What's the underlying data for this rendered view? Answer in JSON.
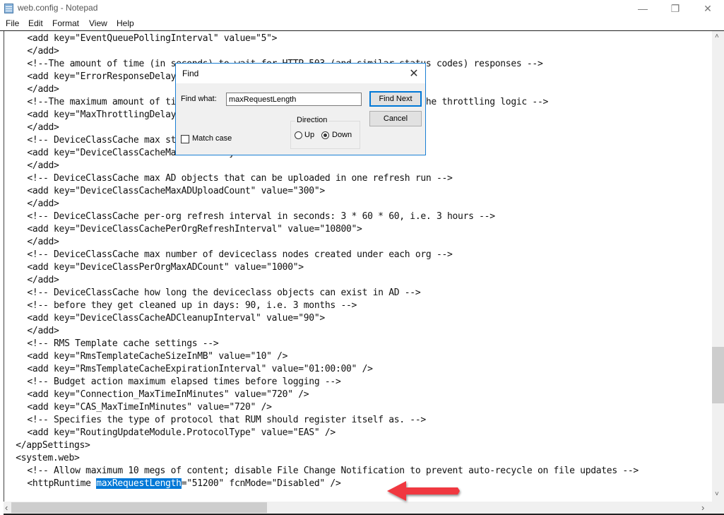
{
  "window": {
    "title": "web.config - Notepad",
    "minimize_glyph": "—",
    "maximize_glyph": "❐",
    "close_glyph": "✕"
  },
  "menu": [
    "File",
    "Edit",
    "Format",
    "View",
    "Help"
  ],
  "editor": {
    "lines": [
      {
        "indent": 4,
        "text": "<add key=\"EventQueuePollingInterval\" value=\"5\">"
      },
      {
        "indent": 4,
        "text": "</add>"
      },
      {
        "indent": 4,
        "text": "<!--The amount of time (in seconds) to wait for HTTP 503 (and similar status codes) responses -->"
      },
      {
        "indent": 4,
        "text": "<add key=\"ErrorResponseDelay\" value=\"0\">"
      },
      {
        "indent": 4,
        "text": "</add>"
      },
      {
        "indent": 4,
        "text": "<!--The maximum amount of time (in seconds) for requests to be delayed by the throttling logic -->"
      },
      {
        "indent": 4,
        "text": "<add key=\"MaxThrottlingDelay\" value=\"0\">"
      },
      {
        "indent": 4,
        "text": "</add>"
      },
      {
        "indent": 4,
        "text": "<!-- DeviceClassCache max start delay in seconds: 6 hours -->"
      },
      {
        "indent": 4,
        "text": "<add key=\"DeviceClassCacheMaxStartDelay\" value=\"21600\">"
      },
      {
        "indent": 4,
        "text": "</add>"
      },
      {
        "indent": 4,
        "text": "<!-- DeviceClassCache max AD objects that can be uploaded in one refresh run -->"
      },
      {
        "indent": 4,
        "text": "<add key=\"DeviceClassCacheMaxADUploadCount\" value=\"300\">"
      },
      {
        "indent": 4,
        "text": "</add>"
      },
      {
        "indent": 4,
        "text": "<!-- DeviceClassCache per-org refresh interval in seconds: 3 * 60 * 60, i.e. 3 hours -->"
      },
      {
        "indent": 4,
        "text": "<add key=\"DeviceClassCachePerOrgRefreshInterval\" value=\"10800\">"
      },
      {
        "indent": 4,
        "text": "</add>"
      },
      {
        "indent": 4,
        "text": "<!-- DeviceClassCache max number of deviceclass nodes created under each org -->"
      },
      {
        "indent": 4,
        "text": "<add key=\"DeviceClassPerOrgMaxADCount\" value=\"1000\">"
      },
      {
        "indent": 4,
        "text": "</add>"
      },
      {
        "indent": 4,
        "text": "<!-- DeviceClassCache how long the deviceclass objects can exist in AD -->"
      },
      {
        "indent": 4,
        "text": "<!-- before they get cleaned up in days: 90, i.e. 3 months -->"
      },
      {
        "indent": 4,
        "text": "<add key=\"DeviceClassCacheADCleanupInterval\" value=\"90\">"
      },
      {
        "indent": 4,
        "text": "</add>"
      },
      {
        "indent": 4,
        "text": "<!-- RMS Template cache settings -->"
      },
      {
        "indent": 4,
        "text": "<add key=\"RmsTemplateCacheSizeInMB\" value=\"10\" />"
      },
      {
        "indent": 4,
        "text": "<add key=\"RmsTemplateCacheExpirationInterval\" value=\"01:00:00\" />"
      },
      {
        "indent": 4,
        "text": "<!-- Budget action maximum elapsed times before logging -->"
      },
      {
        "indent": 4,
        "text": "<add key=\"Connection_MaxTimeInMinutes\" value=\"720\" />"
      },
      {
        "indent": 4,
        "text": "<add key=\"CAS_MaxTimeInMinutes\" value=\"720\" />"
      },
      {
        "indent": 4,
        "text": "<!-- Specifies the type of protocol that RUM should register itself as. -->"
      },
      {
        "indent": 4,
        "text": "<add key=\"RoutingUpdateModule.ProtocolType\" value=\"EAS\" />"
      },
      {
        "indent": 2,
        "text": "</appSettings>"
      },
      {
        "indent": 2,
        "text": "<system.web>"
      },
      {
        "indent": 4,
        "text": "<!-- Allow maximum 10 megs of content; disable File Change Notification to prevent auto-recycle on file updates -->"
      }
    ],
    "highlight_line": {
      "indent": 4,
      "before": "<httpRuntime ",
      "selected": "maxRequestLength",
      "after": "=\"51200\" fcnMode=\"Disabled\" />"
    },
    "selection_color": "#0078d7"
  },
  "find_dialog": {
    "title": "Find",
    "find_what_label": "Find what:",
    "find_what_value": "maxRequestLength",
    "find_next_label": "Find Next",
    "cancel_label": "Cancel",
    "direction_label": "Direction",
    "up_label": "Up",
    "down_label": "Down",
    "direction_selected": "Down",
    "match_case_label": "Match case",
    "match_case_checked": false
  },
  "annotation": {
    "arrow_color": "#f0373f"
  },
  "scrollbars": {
    "up_glyph": "˄",
    "down_glyph": "˅",
    "left_glyph": "‹",
    "right_glyph": "›"
  }
}
